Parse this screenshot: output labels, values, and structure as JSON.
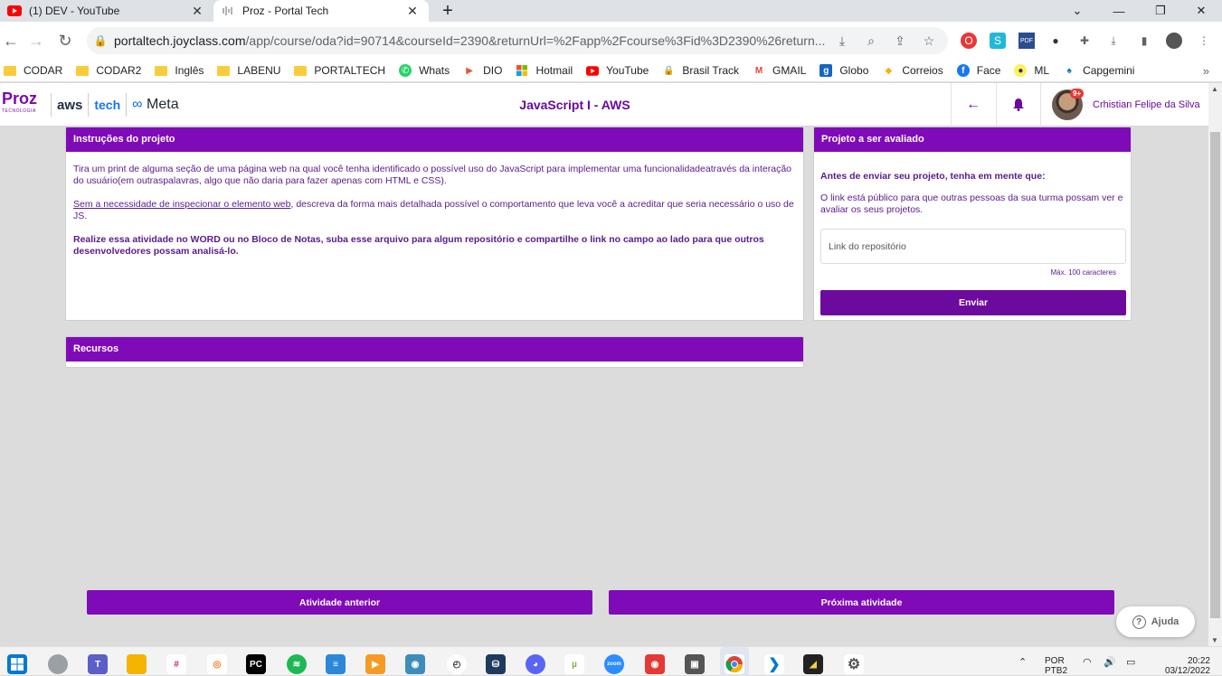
{
  "browser": {
    "tabs": [
      {
        "title": "(1) DEV - YouTube",
        "icon": "youtube-icon",
        "active": false
      },
      {
        "title": "Proz - Portal Tech",
        "icon": "audio-wave-icon",
        "active": true
      }
    ],
    "url_host": "portaltech.joyclass.com",
    "url_path": "/app/course/oda?id=90714&courseId=2390&returnUrl=%2Fapp%2Fcourse%3Fid%3D2390%26return...",
    "bookmarks": [
      {
        "label": "CODAR",
        "icon": "folder-icon"
      },
      {
        "label": "CODAR2",
        "icon": "folder-icon"
      },
      {
        "label": "Inglês",
        "icon": "folder-icon"
      },
      {
        "label": "LABENU",
        "icon": "folder-icon"
      },
      {
        "label": "PORTALTECH",
        "icon": "folder-icon"
      },
      {
        "label": "Whats",
        "icon": "whatsapp-icon"
      },
      {
        "label": "DIO",
        "icon": "dio-icon"
      },
      {
        "label": "Hotmail",
        "icon": "microsoft-icon"
      },
      {
        "label": "YouTube",
        "icon": "youtube-icon"
      },
      {
        "label": "Brasil Track",
        "icon": "lock-icon"
      },
      {
        "label": "GMAIL",
        "icon": "gmail-icon"
      },
      {
        "label": "Globo",
        "icon": "globo-icon"
      },
      {
        "label": "Correios",
        "icon": "correios-icon"
      },
      {
        "label": "Face",
        "icon": "facebook-icon"
      },
      {
        "label": "ML",
        "icon": "mercadolivre-icon"
      },
      {
        "label": "Capgemini",
        "icon": "capgemini-icon"
      }
    ]
  },
  "header": {
    "logo_proz": "Proz",
    "logo_proz_sub": "TECNOLOGIA",
    "logo_aws": "aws",
    "logo_tech": "tech",
    "logo_meta": "Meta",
    "title": "JavaScript I - AWS",
    "notifications_badge": "9+",
    "user_name": "Crhistian Felipe da Silva"
  },
  "instructions": {
    "heading": "Instruções do projeto",
    "p1": "Tira um print de alguma seção de uma página web na qual você tenha identificado o possível uso do JavaScript para implementar uma funcionalidadeatravés da interação do usuário(em outraspalavras, algo que não daria para fazer apenas com HTML e CSS).",
    "p2_link": "Sem a necessidade de inspecionar o elemento web",
    "p2_rest": ", descreva da forma mais detalhada possível o comportamento que leva você a acreditar que seria necessário o uso de JS.",
    "p3": "Realize essa atividade no WORD ou no Bloco de Notas, suba esse arquivo para algum repositório e compartilhe o link no campo ao lado para que outros desenvolvedores possam analisá-lo."
  },
  "project": {
    "heading": "Projeto a ser avaliado",
    "subheading": "Antes de enviar seu projeto, tenha em mente que:",
    "text": "O link está público para que outras pessoas da sua turma possam ver e avaliar os seus projetos.",
    "input_placeholder": "Link do repositório",
    "max_chars": "Máx. 100 caracteres",
    "submit_label": "Enviar"
  },
  "resources": {
    "heading": "Recursos"
  },
  "navigation": {
    "prev_label": "Atividade anterior",
    "next_label": "Próxima atividade"
  },
  "help": {
    "label": "Ajuda"
  },
  "taskbar": {
    "lang_top": "POR",
    "lang_bottom": "PTB2",
    "time": "20:22",
    "date": "03/12/2022"
  },
  "colors": {
    "brand_purple": "#7f0ab7",
    "dark_purple": "#6d0a9e",
    "text_purple": "#5a1a8c"
  }
}
